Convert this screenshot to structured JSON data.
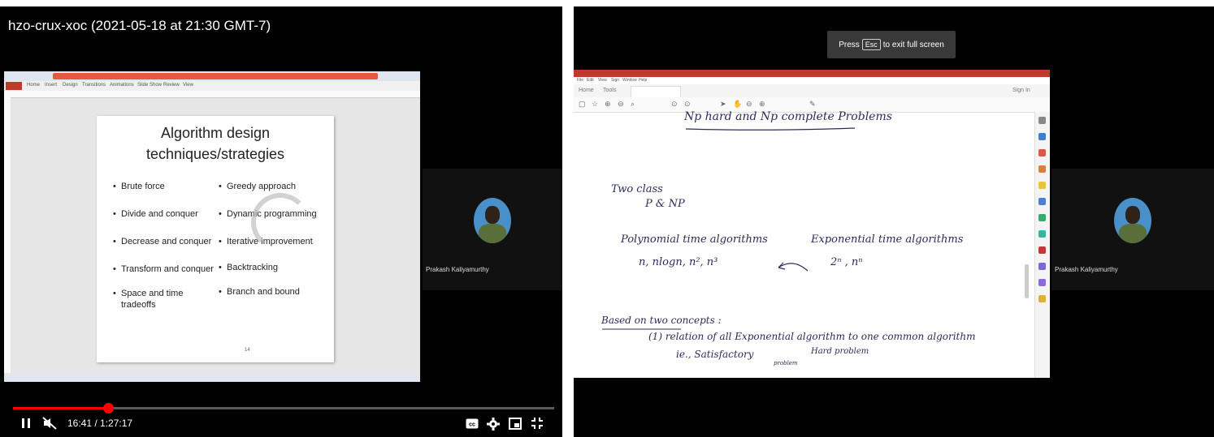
{
  "left": {
    "video_title": "hzo-crux-xoc (2021-05-18 at 21:30 GMT-7)",
    "slide": {
      "title_line1": "Algorithm design",
      "title_line2": "techniques/strategies",
      "left_bullets": [
        "Brute force",
        "Divide and conquer",
        "Decrease and conquer",
        "Transform and conquer",
        "Space and time tradeoffs"
      ],
      "right_bullets": [
        "Greedy approach",
        "Dynamic programming",
        "Iterative improvement",
        "Backtracking",
        "Branch and bound"
      ],
      "page_number": "14"
    },
    "participant_name": "Prakash Kaliyamurthy",
    "player": {
      "current_time": "16:41 / 1:27:17",
      "progress": 0.175,
      "play_pause_icon": "pause-icon",
      "mute_icon": "muted-icon",
      "cc_icon": "captions-icon",
      "settings_icon": "gear-icon",
      "miniplayer_icon": "miniplayer-icon",
      "fullscreen_icon": "exit-fullscreen-icon"
    }
  },
  "right": {
    "esc_toast": {
      "prefix": "Press",
      "key": "Esc",
      "suffix": "to exit full screen"
    },
    "acrobat": {
      "tab_home": "Home",
      "tab_tools": "Tools",
      "sign_in": "Sign In"
    },
    "notes": {
      "heading": "Np hard and Np complete Problems",
      "two_class": "Two class",
      "p_np": "P & NP",
      "poly": "Polynomial time algorithms",
      "poly_examples": "n, nlogn, n², n³",
      "expo": "Exponential time algorithms",
      "expo_examples": "2ⁿ , nⁿ",
      "based_on": "Based on two concepts :",
      "item1": "(1) relation of all Exponential algorithm to one common algorithm",
      "ie": "ie., Satisfactory",
      "problem": "problem",
      "hard_problem": "Hard problem"
    },
    "participant_name": "Prakash Kaliyamurthy"
  },
  "colors": {
    "progress": "#ff0000",
    "ink": "#2a2c5a",
    "acrobat_red": "#c0392b"
  }
}
